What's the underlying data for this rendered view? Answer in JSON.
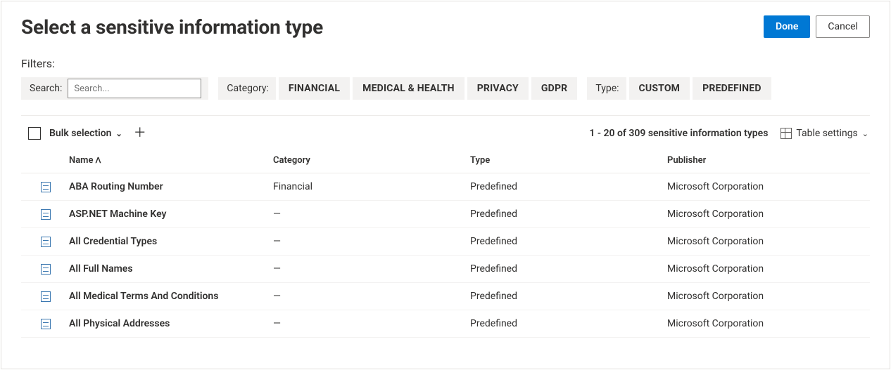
{
  "header": {
    "title": "Select a sensitive information type",
    "done": "Done",
    "cancel": "Cancel"
  },
  "filters": {
    "filters_label": "Filters:",
    "search_label": "Search:",
    "search_placeholder": "Search...",
    "category_label": "Category:",
    "category_options": [
      "FINANCIAL",
      "MEDICAL & HEALTH",
      "PRIVACY",
      "GDPR"
    ],
    "type_label": "Type:",
    "type_options": [
      "CUSTOM",
      "PREDEFINED"
    ]
  },
  "toolbar": {
    "bulk_selection": "Bulk selection",
    "count_text": "1 - 20 of 309 sensitive information types",
    "table_settings": "Table settings"
  },
  "columns": {
    "name": "Name",
    "category": "Category",
    "type": "Type",
    "publisher": "Publisher"
  },
  "rows": [
    {
      "name": "ABA Routing Number",
      "category": "Financial",
      "type": "Predefined",
      "publisher": "Microsoft Corporation"
    },
    {
      "name": "ASP.NET Machine Key",
      "category": "—",
      "type": "Predefined",
      "publisher": "Microsoft Corporation"
    },
    {
      "name": "All Credential Types",
      "category": "—",
      "type": "Predefined",
      "publisher": "Microsoft Corporation"
    },
    {
      "name": "All Full Names",
      "category": "—",
      "type": "Predefined",
      "publisher": "Microsoft Corporation"
    },
    {
      "name": "All Medical Terms And Conditions",
      "category": "—",
      "type": "Predefined",
      "publisher": "Microsoft Corporation"
    },
    {
      "name": "All Physical Addresses",
      "category": "—",
      "type": "Predefined",
      "publisher": "Microsoft Corporation"
    }
  ]
}
